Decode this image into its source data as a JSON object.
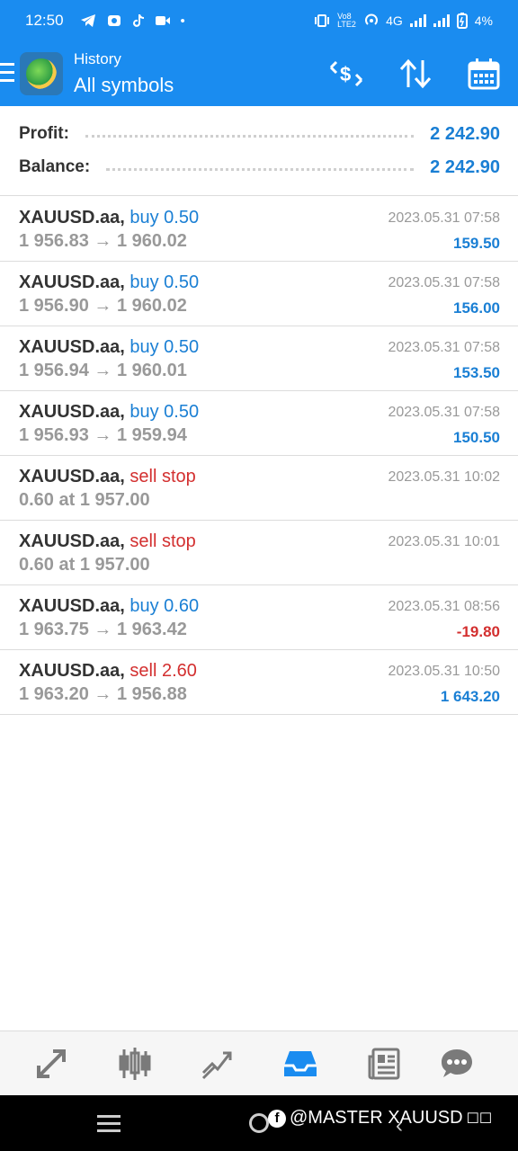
{
  "status_bar": {
    "time": "12:50",
    "network": "4G",
    "battery": "4%",
    "volte": "Vo8 LTE2"
  },
  "header": {
    "subtitle": "History",
    "title": "All symbols"
  },
  "summary": {
    "profit_label": "Profit:",
    "profit_value": "2 242.90",
    "balance_label": "Balance:",
    "balance_value": "2 242.90"
  },
  "trades": [
    {
      "symbol": "XAUUSD.aa,",
      "action": "buy 0.50",
      "side": "buy",
      "prices": "1 956.83 → 1 960.02",
      "time": "2023.05.31 07:58",
      "pl": "159.50",
      "pl_sign": "pos"
    },
    {
      "symbol": "XAUUSD.aa,",
      "action": "buy 0.50",
      "side": "buy",
      "prices": "1 956.90 → 1 960.02",
      "time": "2023.05.31 07:58",
      "pl": "156.00",
      "pl_sign": "pos"
    },
    {
      "symbol": "XAUUSD.aa,",
      "action": "buy 0.50",
      "side": "buy",
      "prices": "1 956.94 → 1 960.01",
      "time": "2023.05.31 07:58",
      "pl": "153.50",
      "pl_sign": "pos"
    },
    {
      "symbol": "XAUUSD.aa,",
      "action": "buy 0.50",
      "side": "buy",
      "prices": "1 956.93 → 1 959.94",
      "time": "2023.05.31 07:58",
      "pl": "150.50",
      "pl_sign": "pos"
    },
    {
      "symbol": "XAUUSD.aa,",
      "action": "sell stop",
      "side": "sell",
      "prices": "0.60 at 1 957.00",
      "time": "2023.05.31 10:02",
      "pl": "",
      "pl_sign": "pos"
    },
    {
      "symbol": "XAUUSD.aa,",
      "action": "sell stop",
      "side": "sell",
      "prices": "0.60 at 1 957.00",
      "time": "2023.05.31 10:01",
      "pl": "",
      "pl_sign": "pos"
    },
    {
      "symbol": "XAUUSD.aa,",
      "action": "buy 0.60",
      "side": "buy",
      "prices": "1 963.75 → 1 963.42",
      "time": "2023.05.31 08:56",
      "pl": "-19.80",
      "pl_sign": "neg"
    },
    {
      "symbol": "XAUUSD.aa,",
      "action": "sell 2.60",
      "side": "sell",
      "prices": "1 963.20 → 1 956.88",
      "time": "2023.05.31 10:50",
      "pl": "1 643.20",
      "pl_sign": "pos"
    }
  ],
  "bottom_tabs": [
    "quotes-icon",
    "chart-icon",
    "trade-icon",
    "history-icon",
    "news-icon",
    "chat-icon"
  ],
  "active_tab": "history-icon",
  "watermark": "@MASTER XAUUSD",
  "colors": {
    "accent": "#1a8cf0",
    "profit": "#1a7fd4",
    "loss": "#d32f2f"
  }
}
